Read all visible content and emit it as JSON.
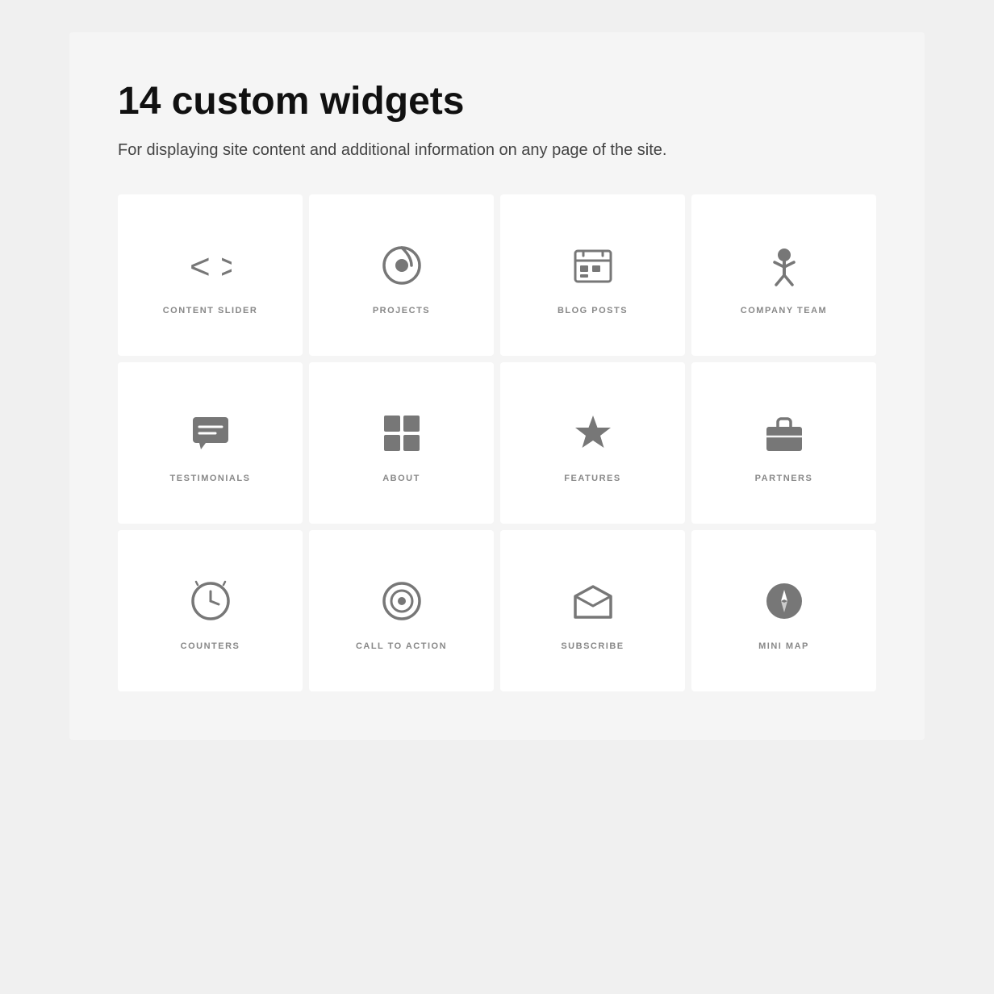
{
  "header": {
    "title": "14 custom widgets",
    "subtitle": "For displaying site content and additional information on any page of the site."
  },
  "widgets": [
    {
      "id": "content-slider",
      "label": "CONTENT SLIDER",
      "icon": "code-brackets"
    },
    {
      "id": "projects",
      "label": "PROJECTS",
      "icon": "projects-circle"
    },
    {
      "id": "blog-posts",
      "label": "BLOG POSTS",
      "icon": "calendar-list"
    },
    {
      "id": "company-team",
      "label": "COMPANY TEAM",
      "icon": "person"
    },
    {
      "id": "testimonials",
      "label": "TESTIMONIALS",
      "icon": "speech-bubble"
    },
    {
      "id": "about",
      "label": "ABOUT",
      "icon": "layout-grid"
    },
    {
      "id": "features",
      "label": "FEATURES",
      "icon": "star"
    },
    {
      "id": "partners",
      "label": "PARTNERS",
      "icon": "briefcase"
    },
    {
      "id": "counters",
      "label": "COUNTERS",
      "icon": "clock"
    },
    {
      "id": "call-to-action",
      "label": "CALL TO ACTION",
      "icon": "target-circle"
    },
    {
      "id": "subscribe",
      "label": "SUBSCRIBE",
      "icon": "envelope-open"
    },
    {
      "id": "mini-map",
      "label": "MINI MAP",
      "icon": "compass"
    }
  ]
}
